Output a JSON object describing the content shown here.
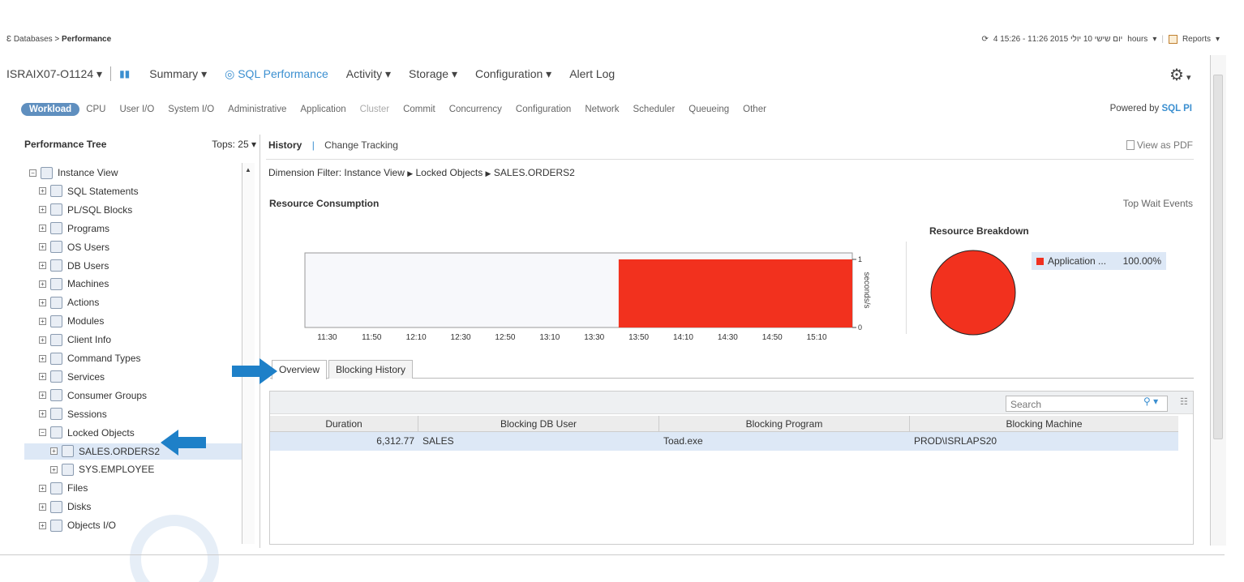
{
  "breadcrumb": {
    "root": "Databases",
    "sep": ">",
    "current": "Performance"
  },
  "timebar": {
    "range": "4 15:26 - 11:26 2015 יום שישי 10 יולי",
    "hours": "hours",
    "reports": "Reports"
  },
  "mainnav": {
    "instance": "ISRAIX07-O1124",
    "items": [
      "Summary",
      "SQL Performance",
      "Activity",
      "Storage",
      "Configuration",
      "Alert Log"
    ]
  },
  "subnav": {
    "active": "Workload",
    "tabs": [
      "CPU",
      "User I/O",
      "System I/O",
      "Administrative",
      "Application",
      "Cluster",
      "Commit",
      "Concurrency",
      "Configuration",
      "Network",
      "Scheduler",
      "Queueing",
      "Other"
    ]
  },
  "powered": {
    "label": "Powered by",
    "logo": "SQL PI"
  },
  "tree": {
    "title": "Performance Tree",
    "tops": "Tops: 25",
    "items": [
      {
        "label": "Instance View",
        "level": 0,
        "icon": "instance-icon"
      },
      {
        "label": "SQL Statements",
        "level": 1,
        "icon": "sql-icon"
      },
      {
        "label": "PL/SQL Blocks",
        "level": 1,
        "icon": "code-icon"
      },
      {
        "label": "Programs",
        "level": 1,
        "icon": "program-icon"
      },
      {
        "label": "OS Users",
        "level": 1,
        "icon": "os-user-icon"
      },
      {
        "label": "DB Users",
        "level": 1,
        "icon": "db-user-icon"
      },
      {
        "label": "Machines",
        "level": 1,
        "icon": "machine-icon"
      },
      {
        "label": "Actions",
        "level": 1,
        "icon": "action-icon"
      },
      {
        "label": "Modules",
        "level": 1,
        "icon": "module-icon"
      },
      {
        "label": "Client Info",
        "level": 1,
        "icon": "client-icon"
      },
      {
        "label": "Command Types",
        "level": 1,
        "icon": "command-icon"
      },
      {
        "label": "Services",
        "level": 1,
        "icon": "service-icon"
      },
      {
        "label": "Consumer Groups",
        "level": 1,
        "icon": "group-icon"
      },
      {
        "label": "Sessions",
        "level": 1,
        "icon": "session-icon"
      },
      {
        "label": "Locked Objects",
        "level": 1,
        "icon": "lock-icon"
      },
      {
        "label": "SALES.ORDERS2",
        "level": 2,
        "icon": "lock-icon",
        "selected": true
      },
      {
        "label": "SYS.EMPLOYEE",
        "level": 2,
        "icon": "lock-icon"
      },
      {
        "label": "Files",
        "level": 1,
        "icon": "file-icon"
      },
      {
        "label": "Disks",
        "level": 1,
        "icon": "disk-icon"
      },
      {
        "label": "Objects I/O",
        "level": 1,
        "icon": "objects-io-icon"
      }
    ]
  },
  "content": {
    "history": "History",
    "change_tracking": "Change Tracking",
    "view_pdf": "View as PDF",
    "dimension_filter": {
      "label": "Dimension Filter:",
      "path": [
        "Instance View",
        "Locked Objects",
        "SALES.ORDERS2"
      ]
    },
    "resource_consumption": "Resource Consumption",
    "top_wait_events": "Top Wait Events",
    "resource_breakdown": "Resource Breakdown",
    "legend": {
      "name": "Application ...",
      "value": "100.00%"
    }
  },
  "chart_data": {
    "type": "area",
    "x": [
      "11:30",
      "11:50",
      "12:10",
      "12:30",
      "12:50",
      "13:10",
      "13:30",
      "13:50",
      "14:10",
      "14:30",
      "14:50",
      "15:10"
    ],
    "series": [
      {
        "name": "Application",
        "start": "13:41",
        "end": "15:26",
        "value": 1
      }
    ],
    "ylabel": "seconds/s",
    "ylim": [
      0,
      1
    ],
    "yticks": [
      "1",
      "0"
    ],
    "color": "#f2311e"
  },
  "pie": {
    "share": 100,
    "color": "#f2311e"
  },
  "tabs": [
    "Overview",
    "Blocking History"
  ],
  "grid": {
    "search_placeholder": "Search",
    "columns": [
      "Duration",
      "Blocking DB User",
      "Blocking Program",
      "Blocking Machine"
    ],
    "rows": [
      [
        "6,312.77",
        "SALES",
        "Toad.exe",
        "PROD\\ISRLAPS20"
      ]
    ]
  }
}
